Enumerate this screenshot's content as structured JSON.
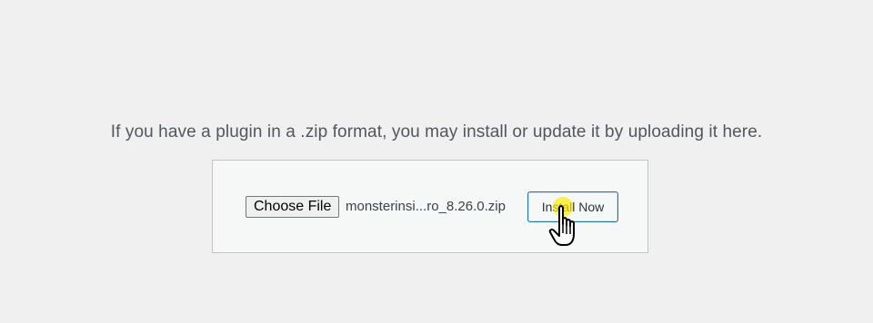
{
  "upload": {
    "intro_text": "If you have a plugin in a .zip format, you may install or update it by uploading it here.",
    "choose_file_label": "Choose File",
    "selected_file_name": "monsterinsi...ro_8.26.0.zip",
    "install_button_label": "Install Now"
  },
  "cursor": {
    "icon": "hand-pointer-icon",
    "highlight_color": "#ffeb00"
  },
  "colors": {
    "background": "#f0f0f1",
    "panel_background": "#f6f7f7",
    "panel_border": "#c3c4c7",
    "accent": "#2271b1"
  }
}
